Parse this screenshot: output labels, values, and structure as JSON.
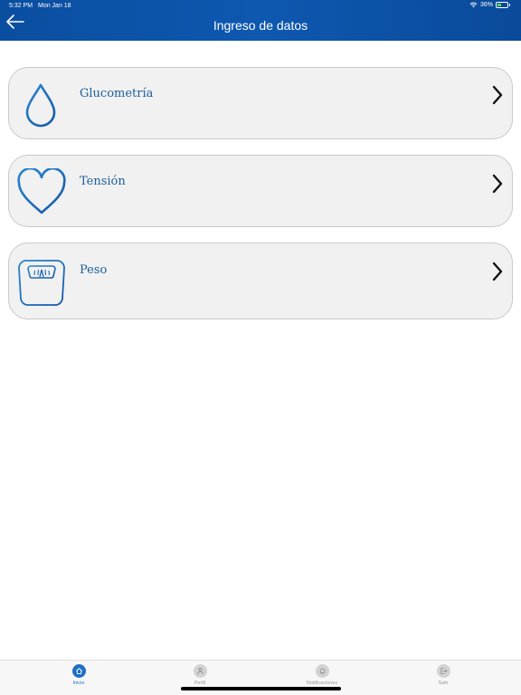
{
  "status_bar": {
    "time": "5:32 PM",
    "date": "Mon Jan 18",
    "battery": "36%"
  },
  "header": {
    "title": "Ingreso de datos",
    "back_icon": "arrow-left-icon"
  },
  "menu": {
    "items": [
      {
        "label": "Glucometría",
        "icon": "water-drop-icon"
      },
      {
        "label": "Tensión",
        "icon": "heart-icon"
      },
      {
        "label": "Peso",
        "icon": "scale-icon"
      }
    ]
  },
  "tabbar": {
    "tabs": [
      {
        "label": "Inicio",
        "icon": "home-icon",
        "active": true
      },
      {
        "label": "Perfil",
        "icon": "person-icon",
        "active": false
      },
      {
        "label": "Notificaciones",
        "icon": "bell-icon",
        "active": false
      },
      {
        "label": "Salir",
        "icon": "logout-icon",
        "active": false
      }
    ]
  },
  "colors": {
    "header": "#0e58b0",
    "accent": "#1e6fc4",
    "label": "#1b5e9c",
    "card_bg": "#f1f1f1"
  }
}
